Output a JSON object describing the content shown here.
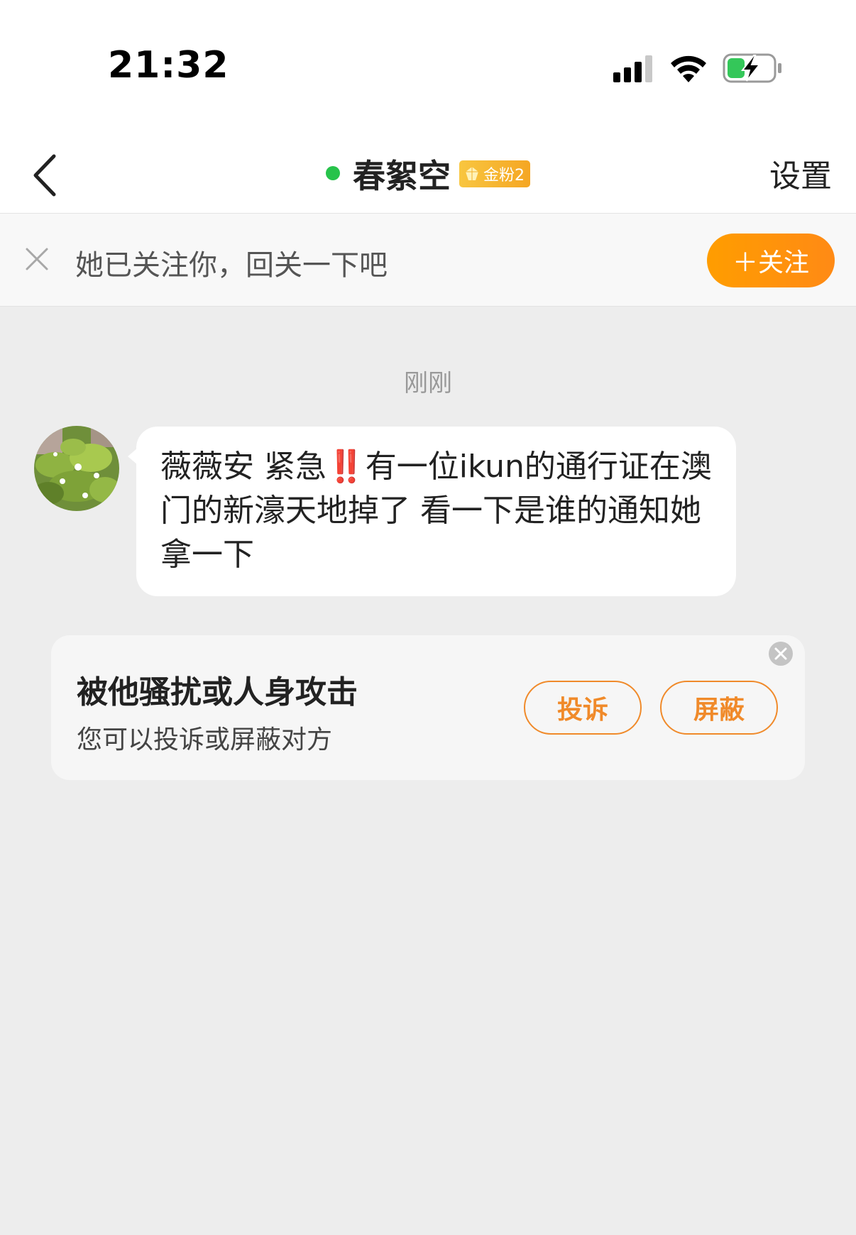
{
  "status_bar": {
    "time": "21:32",
    "signal_icon": "cellular-signal-icon",
    "wifi_icon": "wifi-icon",
    "battery_icon": "battery-charging-icon",
    "battery_color": "#34c759"
  },
  "nav": {
    "back_icon": "chevron-left-icon",
    "title": "春絮空",
    "online_color": "#27c34b",
    "badge_label": "金粉2",
    "badge_icon": "gem-icon",
    "settings_label": "设置"
  },
  "follow_banner": {
    "close_icon": "close-icon",
    "text": "她已关注你，回关一下吧",
    "follow_label": "＋关注",
    "accent": "#ff9000"
  },
  "chat": {
    "timestamp": "刚刚",
    "avatar_icon": "avatar-image",
    "message_before": "薇薇安 紧急",
    "message_emoji": "‼️",
    "message_after": "有一位ikun的通行证在澳门的新濠天地掉了 看一下是谁的通知她拿一下"
  },
  "report_card": {
    "title": "被他骚扰或人身攻击",
    "subtitle": "您可以投诉或屏蔽对方",
    "complain_label": "投诉",
    "block_label": "屏蔽",
    "close_icon": "close-circle-icon",
    "accent": "#f08a2a"
  }
}
